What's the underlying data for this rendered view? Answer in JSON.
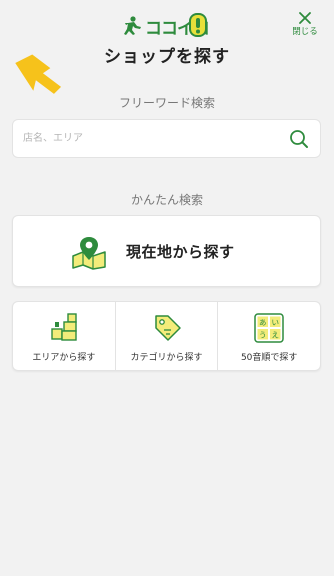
{
  "header": {
    "logo_text": "ココイコ!",
    "title": "ショップを探す",
    "close_label": "閉じる"
  },
  "free_word": {
    "title": "フリーワード検索",
    "placeholder": "店名、エリア"
  },
  "easy_search": {
    "title": "かんたん検索",
    "location_label": "現在地から探す",
    "options": [
      {
        "label": "エリアから探す",
        "icon": "area-map-icon"
      },
      {
        "label": "カテゴリから探す",
        "icon": "category-tag-icon"
      },
      {
        "label": "50音順で探す",
        "icon": "kana-grid-icon"
      }
    ],
    "kana": [
      "あ",
      "い",
      "う",
      "え"
    ]
  },
  "colors": {
    "accent_green": "#2e8b3d",
    "icon_yellow": "#f3ec7a",
    "arrow_yellow": "#f6c21b",
    "background": "#f2f2f2"
  }
}
